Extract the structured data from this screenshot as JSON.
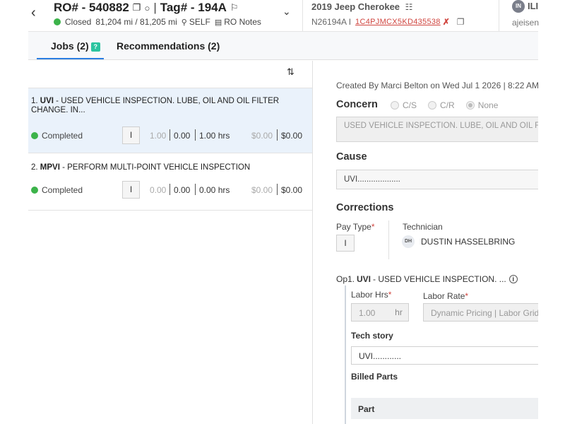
{
  "header": {
    "ro_label": "RO# - 540882",
    "tag_label": "Tag# - 194A",
    "status": "Closed",
    "mileage": "81,204 mi / 81,205 mi",
    "customer_type": "SELF",
    "ro_notes_label": "RO Notes",
    "vehicle": "2019 Jeep Cherokee",
    "stock": "N26194A I",
    "vin": "1C4PJMCX5KD435538",
    "user_initials": "IN",
    "user_name": "ILI",
    "user_email": "ajeisen",
    "status_color": "#3cb34a"
  },
  "tabs": {
    "jobs_label": "Jobs (2)",
    "jobs_badge": "?",
    "recs_label": "Recommendations (2)"
  },
  "jobs": [
    {
      "number": "1.",
      "code": "UVI",
      "desc": " - USED VEHICLE INSPECTION. LUBE, OIL AND OIL FILTER CHANGE. IN...",
      "status": "Completed",
      "pay_type": "I",
      "est_hrs": "1.00",
      "act_hrs": "0.00",
      "sold_hrs": "1.00 hrs",
      "price1": "$0.00",
      "price2": "$0.00"
    },
    {
      "number": "2.",
      "code": "MPVI",
      "desc": " - PERFORM MULTI-POINT VEHICLE INSPECTION",
      "status": "Completed",
      "pay_type": "I",
      "est_hrs": "0.00",
      "act_hrs": "0.00",
      "sold_hrs": "0.00 hrs",
      "price1": "$0.00",
      "price2": "$0.00"
    }
  ],
  "detail": {
    "created": "Created By Marci Belton on Wed Jul 1 2026 | 8:22 AM",
    "concern_title": "Concern",
    "radio_cs": "C/S",
    "radio_cr": "C/R",
    "radio_none": "None",
    "concern_text": "USED VEHICLE INSPECTION. LUBE, OIL AND OIL FILTER CHANGE",
    "cause_title": "Cause",
    "cause_text": "UVI...................",
    "corrections_title": "Corrections",
    "pay_type_label": "Pay Type",
    "pay_type_value": "I",
    "technician_label": "Technician",
    "tech_initials": "DH",
    "tech_name": "DUSTIN HASSELBRING",
    "op_prefix": "Op1.",
    "op_code": "UVI",
    "op_desc": "- USED VEHICLE INSPECTION. ...",
    "labor_hrs_label": "Labor Hrs",
    "labor_hrs_value": "1.00",
    "labor_hrs_unit": "hr",
    "labor_rate_label": "Labor Rate",
    "labor_rate_value": "Dynamic Pricing | Labor Grid",
    "tech_story_label": "Tech story",
    "tech_story_value": "UVI............",
    "billed_parts_label": "Billed Parts",
    "part_col": "Part",
    "required_mark": "*"
  }
}
